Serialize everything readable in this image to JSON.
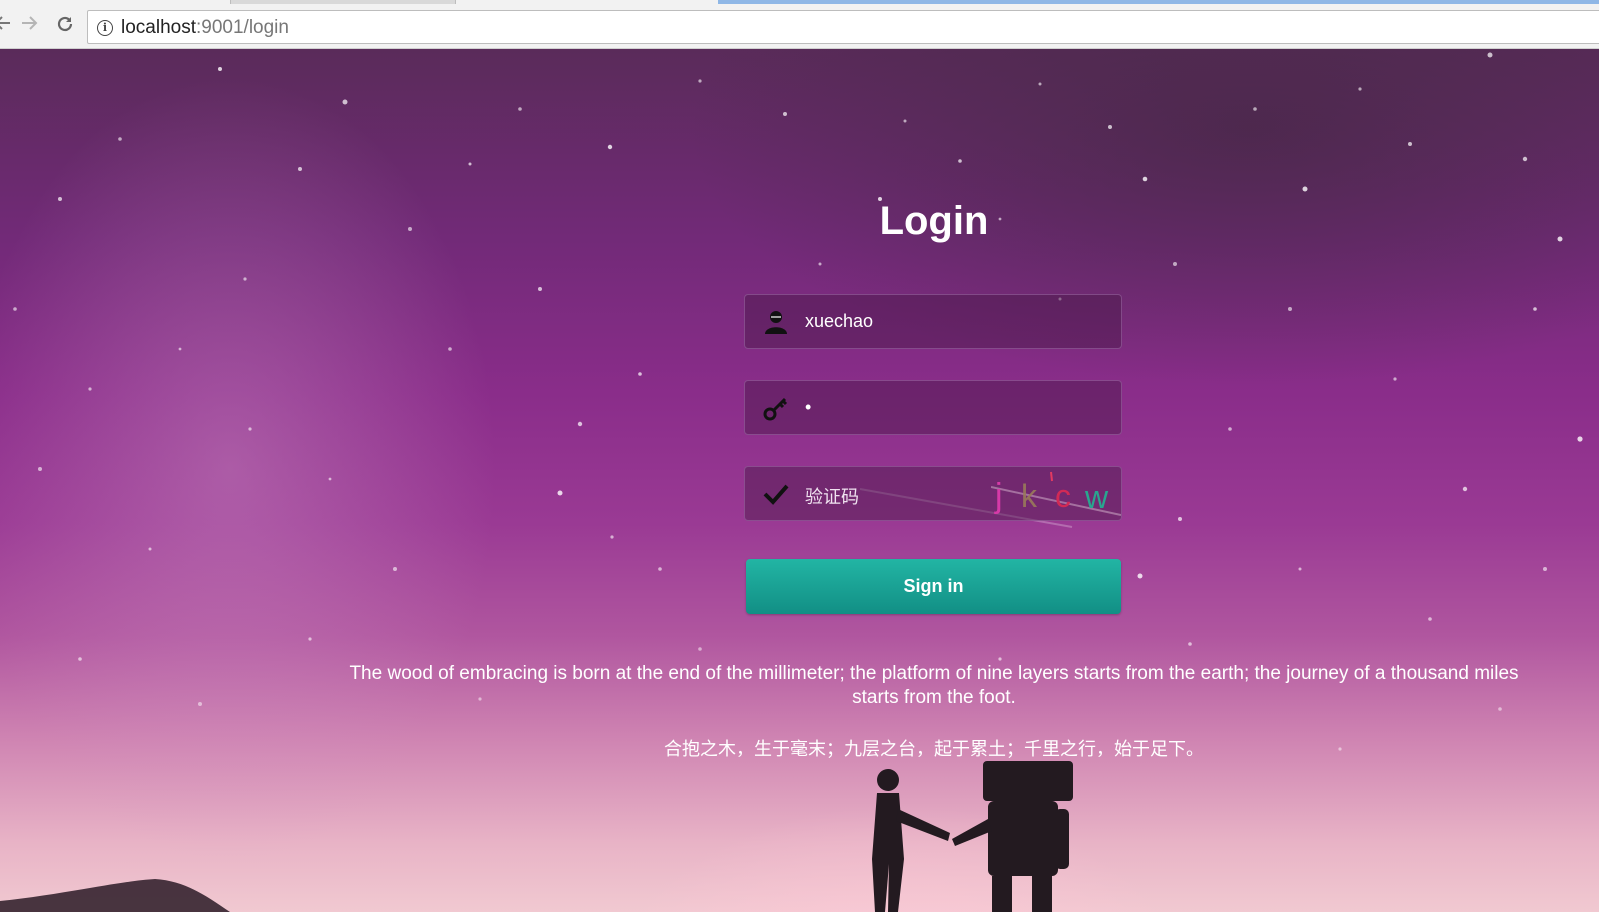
{
  "browser": {
    "url_host": "localhost",
    "url_rest": ":9001/login",
    "back_icon": "arrow-left-icon",
    "forward_icon": "arrow-right-icon",
    "reload_icon": "reload-icon",
    "info_icon": "info-icon",
    "info_glyph": "i"
  },
  "login": {
    "title": "Login",
    "username_value": "xuechao",
    "password_value": "•",
    "captcha_placeholder": "验证码",
    "captcha_text": "jkcw",
    "signin_label": "Sign in"
  },
  "quote": {
    "english": "The wood of embracing is born at the end of the millimeter; the platform of nine layers starts from the earth; the journey of a thousand miles starts from the foot.",
    "chinese": "合抱之木，生于毫末；九层之台，起于累土；千里之行，始于足下。"
  },
  "colors": {
    "accent": "#1aa597",
    "text": "#ffffff"
  }
}
